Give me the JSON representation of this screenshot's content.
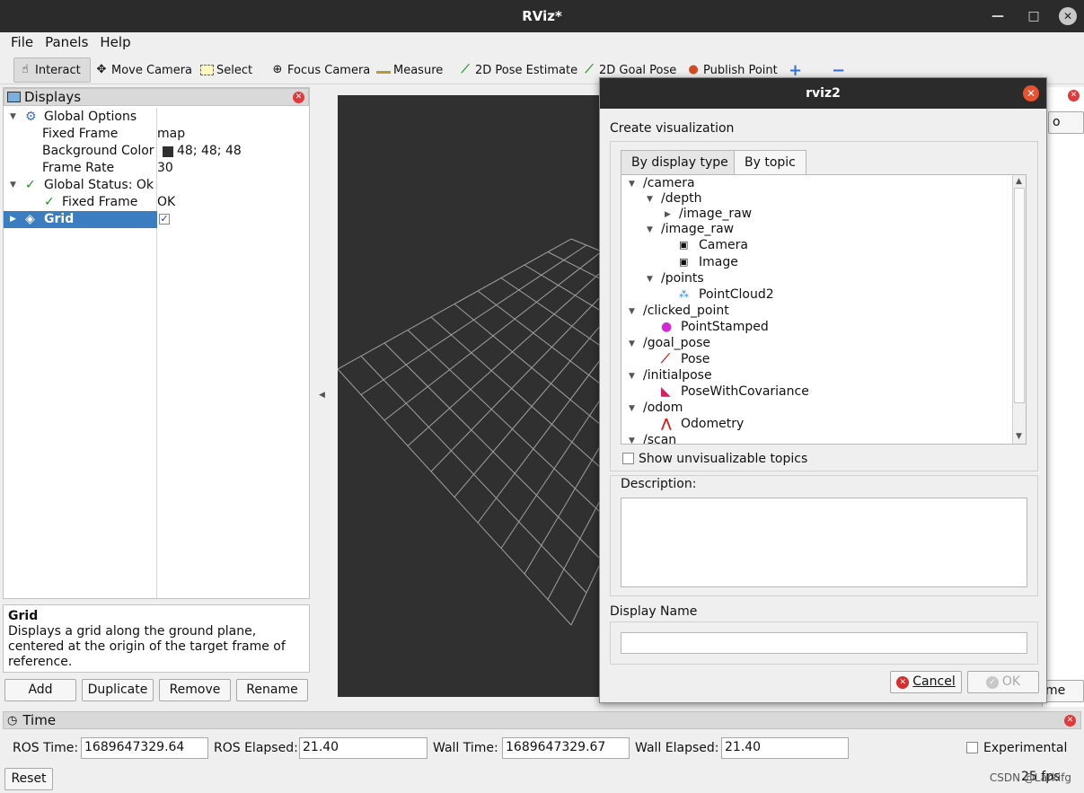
{
  "window": {
    "title": "RViz*",
    "min": "—",
    "max": "□",
    "close": "✕"
  },
  "menu": [
    "File",
    "Panels",
    "Help"
  ],
  "toolbar": {
    "interact": "Interact",
    "move_camera": "Move Camera",
    "select": "Select",
    "focus_camera": "Focus Camera",
    "measure": "Measure",
    "pose_estimate": "2D Pose Estimate",
    "goal_pose": "2D Goal Pose",
    "publish_point": "Publish Point",
    "plus": "+",
    "minus": "−"
  },
  "displays": {
    "title": "Displays",
    "rows": {
      "global_options": "Global Options",
      "fixed_frame": "Fixed Frame",
      "fixed_frame_val": "map",
      "bg_color": "Background Color",
      "bg_color_val": "48; 48; 48",
      "frame_rate": "Frame Rate",
      "frame_rate_val": "30",
      "global_status": "Global Status: Ok",
      "status_fixed_frame": "Fixed Frame",
      "status_fixed_frame_val": "OK",
      "grid": "Grid"
    },
    "desc_title": "Grid",
    "desc_text": "Displays a grid along the ground plane, centered at the origin of the target frame of reference.",
    "buttons": {
      "add": "Add",
      "duplicate": "Duplicate",
      "remove": "Remove",
      "rename": "Rename"
    }
  },
  "time": {
    "title": "Time",
    "ros_time_label": "ROS Time:",
    "ros_time": "1689647329.64",
    "ros_elapsed_label": "ROS Elapsed:",
    "ros_elapsed": "21.40",
    "wall_time_label": "Wall Time:",
    "wall_time": "1689647329.67",
    "wall_elapsed_label": "Wall Elapsed:",
    "wall_elapsed": "21.40",
    "experimental": "Experimental",
    "reset": "Reset",
    "fps": "25 fps"
  },
  "dialog": {
    "title": "rviz2",
    "heading": "Create visualization",
    "tabs": [
      "By display type",
      "By topic"
    ],
    "topics": [
      {
        "label": "/camera"
      },
      {
        "label": "/depth"
      },
      {
        "label": "/image_raw"
      },
      {
        "label": "/image_raw"
      },
      {
        "label": "Camera"
      },
      {
        "label": "Image"
      },
      {
        "label": "/points"
      },
      {
        "label": "PointCloud2"
      },
      {
        "label": "/clicked_point"
      },
      {
        "label": "PointStamped"
      },
      {
        "label": "/goal_pose"
      },
      {
        "label": "Pose"
      },
      {
        "label": "/initialpose"
      },
      {
        "label": "PoseWithCovariance"
      },
      {
        "label": "/odom"
      },
      {
        "label": "Odometry"
      },
      {
        "label": "/scan"
      }
    ],
    "show_unvisualizable": "Show unvisualizable topics",
    "description_label": "Description:",
    "display_name_label": "Display Name",
    "cancel": "Cancel",
    "ok": "OK"
  },
  "watermark": "CSDN @Larkifg",
  "right_fragments": {
    "o": "o",
    "me": "me"
  }
}
